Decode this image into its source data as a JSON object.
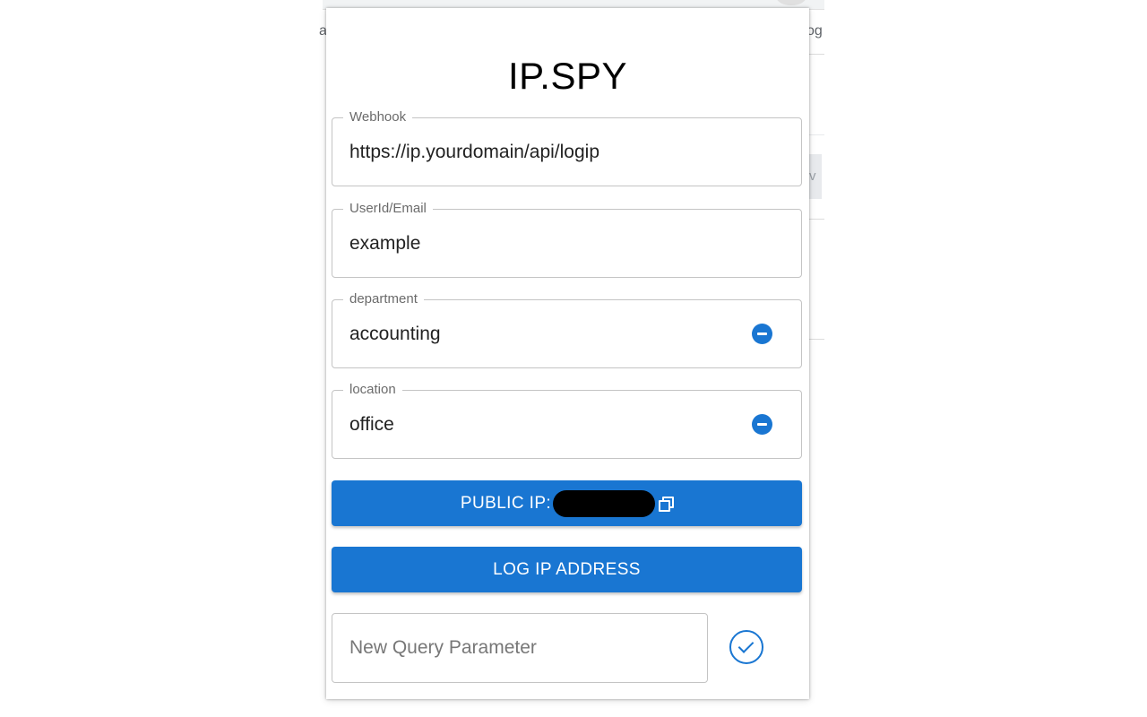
{
  "background": {
    "left_fragment": "a",
    "right_fragment": "og",
    "right_mid_fragment": "v"
  },
  "popup": {
    "title": "IP.SPY",
    "fields": {
      "webhook": {
        "label": "Webhook",
        "value": "https://ip.yourdomain/api/logip"
      },
      "user": {
        "label": "UserId/Email",
        "value": "example"
      },
      "department": {
        "label": "department",
        "value": "accounting",
        "icon": "remove-circle-icon"
      },
      "location": {
        "label": "location",
        "value": "office",
        "icon": "remove-circle-icon"
      }
    },
    "public_ip_button": {
      "label": "PUBLIC IP:",
      "icon": "copy-icon"
    },
    "log_button": {
      "label": "LOG IP ADDRESS"
    },
    "new_param": {
      "placeholder": "New Query Parameter",
      "value": ""
    },
    "confirm_icon": "check-circle-icon",
    "colors": {
      "primary": "#1976d2",
      "border": "#c4c4c4"
    }
  }
}
